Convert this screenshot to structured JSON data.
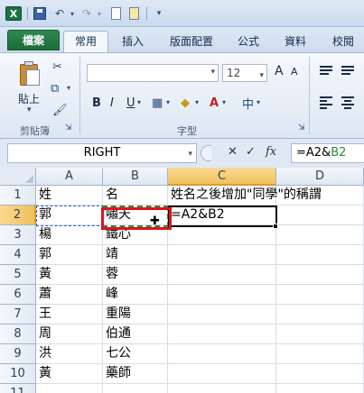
{
  "window": {
    "app_icon": "excel-icon",
    "quick_access": [
      "save-icon",
      "undo-icon",
      "redo-icon",
      "new-icon",
      "open-icon",
      "customize-icon"
    ]
  },
  "ribbon_tabs": [
    {
      "label": "檔案",
      "type": "file"
    },
    {
      "label": "常用",
      "type": "active"
    },
    {
      "label": "插入",
      "type": "normal"
    },
    {
      "label": "版面配置",
      "type": "normal"
    },
    {
      "label": "公式",
      "type": "normal"
    },
    {
      "label": "資料",
      "type": "normal"
    },
    {
      "label": "校閱",
      "type": "normal"
    }
  ],
  "ribbon": {
    "clipboard": {
      "paste_label": "貼上",
      "group_label": "剪貼簿"
    },
    "font": {
      "size_value": "12",
      "group_label": "字型",
      "bold": "B",
      "italic": "I",
      "underline": "U",
      "grow": "A",
      "shrink": "A",
      "phonetic": "中"
    }
  },
  "formula_bar": {
    "name_box": "RIGHT",
    "cancel": "✕",
    "enter": "✓",
    "fx": "fx",
    "formula_prefix": "=A2&",
    "formula_ref": "B2"
  },
  "columns": [
    "A",
    "B",
    "C",
    "D"
  ],
  "rows": [
    {
      "num": "1",
      "a": "姓",
      "b": "名",
      "c": "姓名之後增加\"同學\"的稱謂"
    },
    {
      "num": "2",
      "a": "郭",
      "b": "嘯天",
      "c": "=A2&B2"
    },
    {
      "num": "3",
      "a": "楊",
      "b": "鐵心",
      "c": ""
    },
    {
      "num": "4",
      "a": "郭",
      "b": "靖",
      "c": ""
    },
    {
      "num": "5",
      "a": "黃",
      "b": "蓉",
      "c": ""
    },
    {
      "num": "6",
      "a": "蕭",
      "b": "峰",
      "c": ""
    },
    {
      "num": "7",
      "a": "王",
      "b": "重陽",
      "c": ""
    },
    {
      "num": "8",
      "a": "周",
      "b": "伯通",
      "c": ""
    },
    {
      "num": "9",
      "a": "洪",
      "b": "七公",
      "c": ""
    },
    {
      "num": "10",
      "a": "黃",
      "b": "藥師",
      "c": ""
    },
    {
      "num": "11",
      "a": "",
      "b": "",
      "c": ""
    }
  ],
  "colors": {
    "ref_a": "#2b58c9",
    "ref_b": "#2c8a3a",
    "highlight": "#e0131a",
    "selected_header": "#f1c15f"
  }
}
